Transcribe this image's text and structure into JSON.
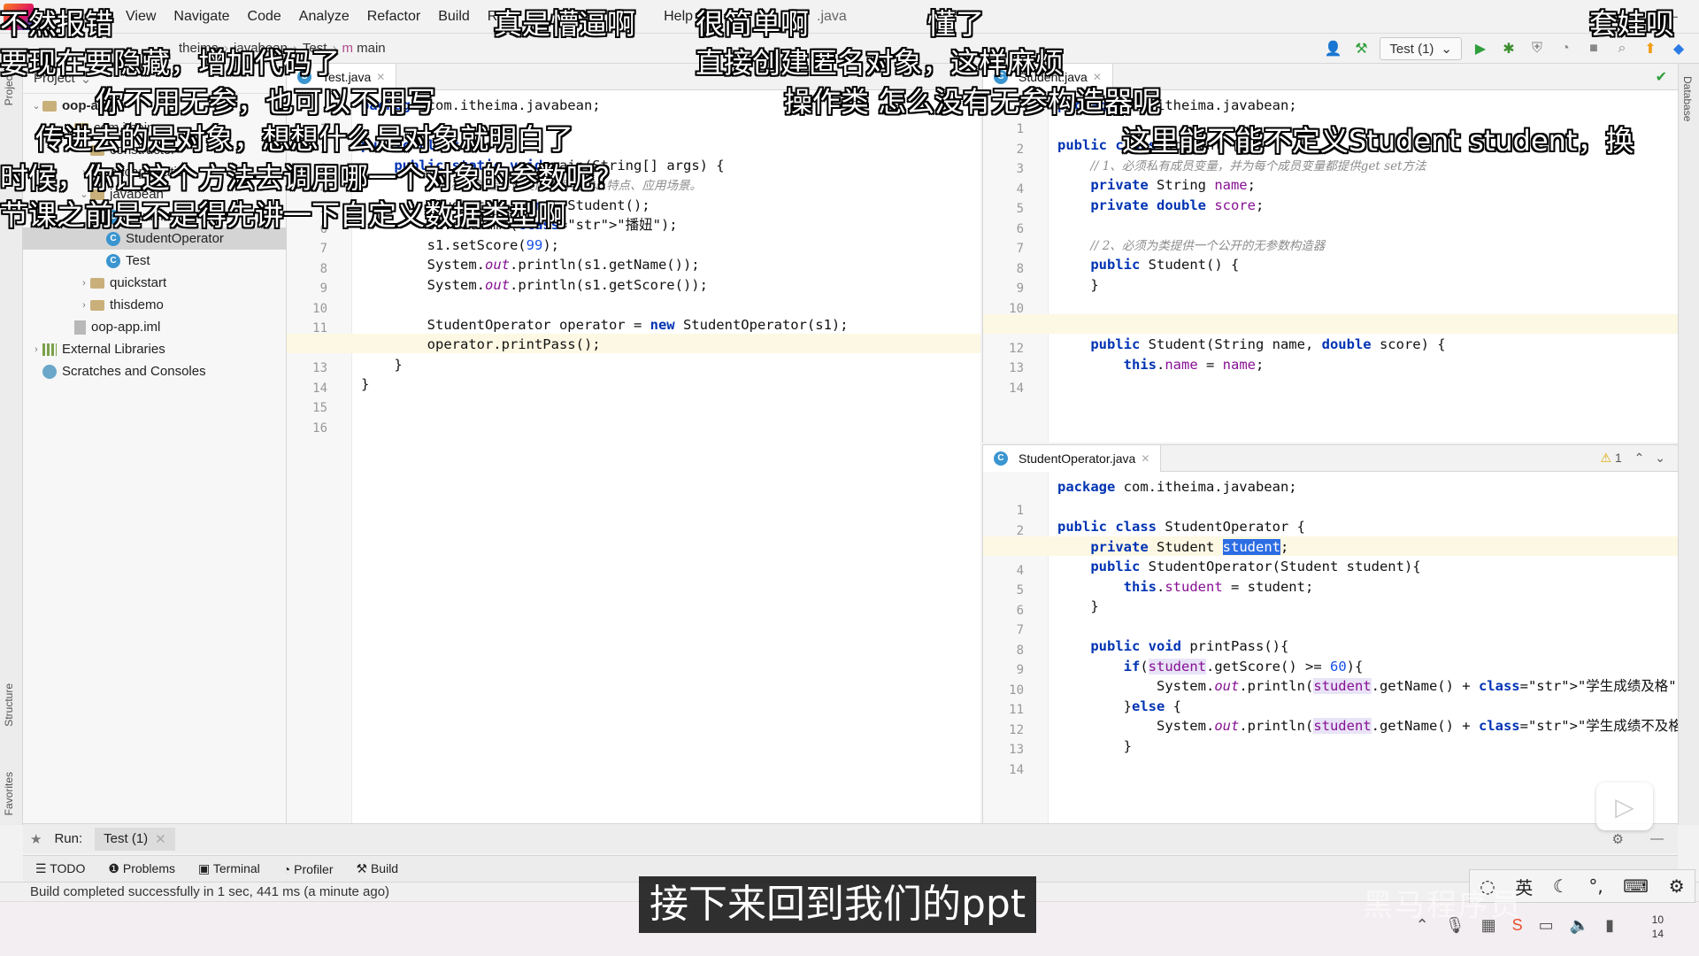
{
  "menubar": {
    "items": [
      "View",
      "Navigate",
      "Code",
      "Analyze",
      "Refactor",
      "Build",
      "Run",
      "Help"
    ],
    "file_suffix": ".java",
    "window_minimize": "–"
  },
  "toolbar": {
    "crumbs": [
      "theima",
      "javabean",
      "Test",
      "main"
    ],
    "run_config": "Test (1)"
  },
  "left_strip": {
    "project": "Project",
    "structure": "Structure",
    "favorites": "Favorites"
  },
  "right_strip": {
    "database": "Database"
  },
  "project_panel": {
    "header": "Project",
    "tree": [
      {
        "label": "oop-app",
        "indent": 0,
        "icon": "folder",
        "arrow": "down",
        "bold": true
      },
      {
        "label": "com.itheima",
        "indent": 2,
        "icon": "folder",
        "arrow": "down"
      },
      {
        "label": "constructor",
        "indent": 3,
        "icon": "folder",
        "arrow": "right"
      },
      {
        "label": "encapsulation",
        "indent": 3,
        "icon": "folder",
        "arrow": "right"
      },
      {
        "label": "javabean",
        "indent": 3,
        "icon": "folder",
        "arrow": "down"
      },
      {
        "label": "Student",
        "indent": 4,
        "icon": "class"
      },
      {
        "label": "StudentOperator",
        "indent": 4,
        "icon": "class",
        "selected": true
      },
      {
        "label": "Test",
        "indent": 4,
        "icon": "class-run"
      },
      {
        "label": "quickstart",
        "indent": 3,
        "icon": "folder",
        "arrow": "right"
      },
      {
        "label": "thisdemo",
        "indent": 3,
        "icon": "folder",
        "arrow": "right"
      },
      {
        "label": "oop-app.iml",
        "indent": 2,
        "icon": "file"
      },
      {
        "label": "External Libraries",
        "indent": 0,
        "icon": "lib",
        "arrow": "right"
      },
      {
        "label": "Scratches and Consoles",
        "indent": 0,
        "icon": "scratch"
      }
    ]
  },
  "editor_test": {
    "tab": "Test.java",
    "lines": [
      {
        "n": "1",
        "t": "package com.itheima.javabean;"
      },
      {
        "n": "2",
        "t": ""
      },
      {
        "n": "3",
        "t": "public class Test {"
      },
      {
        "n": "4",
        "t": "    public static void main(String[] args) {"
      },
      {
        "n": "5",
        "t": "        // 目标：掌握实体类的书写要求、特点、应用场景。"
      },
      {
        "n": "6",
        "t": "        Student s1 = new Student();"
      },
      {
        "n": "7",
        "t": "        s1.setName(\"播妞\");"
      },
      {
        "n": "8",
        "t": "        s1.setScore(99);"
      },
      {
        "n": "9",
        "t": "        System.out.println(s1.getName());"
      },
      {
        "n": "10",
        "t": "        System.out.println(s1.getScore());"
      },
      {
        "n": "11",
        "t": ""
      },
      {
        "n": "12",
        "t": "        StudentOperator operator = new StudentOperator(s1);"
      },
      {
        "n": "13",
        "t": "        operator.printPass();"
      },
      {
        "n": "14",
        "t": "    }"
      },
      {
        "n": "15",
        "t": "}"
      },
      {
        "n": "16",
        "t": ""
      }
    ]
  },
  "editor_student": {
    "tab": "Student.java",
    "lines": [
      {
        "n": "1",
        "t": "package com.itheima.javabean;"
      },
      {
        "n": "2",
        "t": ""
      },
      {
        "n": "3",
        "t": "public class Student {"
      },
      {
        "n": "4",
        "t": "    // 1、必须私有成员变量，并为每个成员变量都提供get set方法"
      },
      {
        "n": "5",
        "t": "    private String name;"
      },
      {
        "n": "6",
        "t": "    private double score;"
      },
      {
        "n": "7",
        "t": ""
      },
      {
        "n": "8",
        "t": "    // 2、必须为类提供一个公开的无参数构造器"
      },
      {
        "n": "9",
        "t": "    public Student() {"
      },
      {
        "n": "10",
        "t": "    }"
      },
      {
        "n": "11",
        "t": ""
      },
      {
        "n": "12",
        "t": ""
      },
      {
        "n": "13",
        "t": "    public Student(String name, double score) {"
      },
      {
        "n": "14",
        "t": "        this.name = name;"
      }
    ]
  },
  "editor_operator": {
    "tab": "StudentOperator.java",
    "warning": "1",
    "lines": [
      {
        "n": "1",
        "t": "package com.itheima.javabean;"
      },
      {
        "n": "2",
        "t": ""
      },
      {
        "n": "3",
        "t": "public class StudentOperator {"
      },
      {
        "n": "4",
        "t": "    private Student student;"
      },
      {
        "n": "5",
        "t": "    public StudentOperator(Student student){"
      },
      {
        "n": "6",
        "t": "        this.student = student;"
      },
      {
        "n": "7",
        "t": "    }"
      },
      {
        "n": "8",
        "t": ""
      },
      {
        "n": "9",
        "t": "    public void printPass(){"
      },
      {
        "n": "10",
        "t": "        if(student.getScore() >= 60){"
      },
      {
        "n": "11",
        "t": "            System.out.println(student.getName() + \"学生成绩及格\");"
      },
      {
        "n": "12",
        "t": "        }else {"
      },
      {
        "n": "13",
        "t": "            System.out.println(student.getName() + \"学生成绩不及格\");"
      },
      {
        "n": "14",
        "t": "        }"
      }
    ]
  },
  "runbar": {
    "label": "Run:",
    "tab": "Test (1)"
  },
  "toolwindows": [
    "TODO",
    "Problems",
    "Terminal",
    "Profiler",
    "Build"
  ],
  "status": "Build completed successfully in 1 sec, 441 ms (a minute ago)",
  "ime": {
    "lang": "英"
  },
  "clock": {
    "line1": "10",
    "line2": "14"
  },
  "subtitle": "接下来回到我们的ppt",
  "watermark": "黑马程序员",
  "danmaku": [
    {
      "text": "不然报错"
    },
    {
      "text": "真是懵逼啊"
    },
    {
      "text": "很简单啊"
    },
    {
      "text": "懂了"
    },
    {
      "text": "套娃呗"
    },
    {
      "text": "要现在要隐藏，增加代码了"
    },
    {
      "text": "直接创建匿名对象，这样麻烦"
    },
    {
      "text": "你不用无参，也可以不用写"
    },
    {
      "text": "操作类 怎么没有无参构造器呢"
    },
    {
      "text": "传进去的是对象，想想什么是对象就明白了"
    },
    {
      "text": "这里能不能不定义Student student，换"
    },
    {
      "text": "时候，你让这个方法去调用哪一个对象的参数呢？"
    },
    {
      "text": "节课之前是不是得先讲一下自定义数据类型啊"
    }
  ]
}
